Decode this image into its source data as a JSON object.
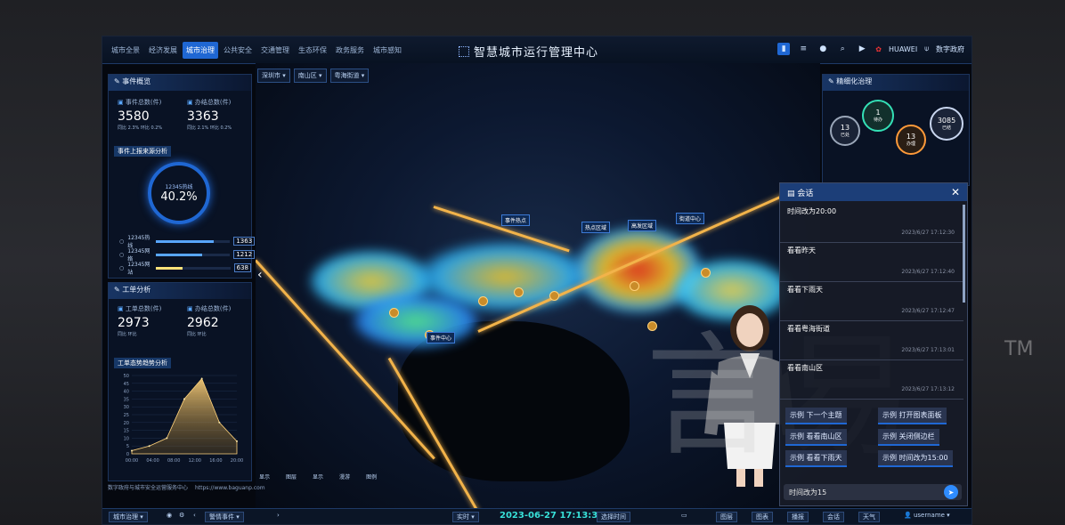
{
  "nav": {
    "items": [
      "城市全景",
      "经济发展",
      "城市治理",
      "公共安全",
      "交通管理",
      "生态环保",
      "政务服务",
      "城市感知"
    ],
    "active_index": 2
  },
  "header": {
    "title": "智慧城市运行管理中心"
  },
  "toolbar": {
    "brand_huawei": "HUAWEI",
    "brand_digital": "数字政府"
  },
  "map": {
    "selectors": [
      "深圳市",
      "南山区",
      "粤海街道"
    ],
    "labels": [
      "事件热点",
      "热点区域",
      "高发区域",
      "街道中心",
      "事件中心"
    ]
  },
  "left_top": {
    "title": "事件概览",
    "stat1_label": "事件总数(件)",
    "stat1_value": "3580",
    "stat1_cmp": "同比 2.3%  环比 0.2%",
    "stat2_label": "办结总数(件)",
    "stat2_value": "3363",
    "stat2_cmp": "同比 2.1%  环比 0.2%",
    "sub_title": "事件上报来源分析",
    "ring_label": "12345热线",
    "ring_value": "40.2%",
    "bars": [
      {
        "label": "12345热线",
        "value": "1363",
        "pct": 0.78
      },
      {
        "label": "12345网络",
        "value": "1212",
        "pct": 0.62
      },
      {
        "label": "12345网站",
        "value": "638",
        "pct": 0.35
      }
    ]
  },
  "left_bottom": {
    "title": "工单分析",
    "stat1_label": "工单总数(件)",
    "stat1_value": "2973",
    "stat1_cmp": "同比  环比",
    "stat2_label": "办结总数(件)",
    "stat2_value": "2962",
    "stat2_cmp": "同比  环比",
    "chart_title": "工单态势趋势分析",
    "footnote": "数字政府与城市安全运营服务中心",
    "url": "https://www.baguanp.com"
  },
  "chart_data": {
    "type": "area",
    "title": "工单态势趋势分析",
    "x": [
      "00:00",
      "04:00",
      "08:00",
      "12:00",
      "16:00",
      "20:00"
    ],
    "values": [
      2,
      5,
      10,
      35,
      48,
      20,
      8
    ],
    "ylim": [
      0,
      50
    ],
    "yticks": [
      0,
      5,
      10,
      15,
      20,
      25,
      30,
      35,
      40,
      45,
      50
    ]
  },
  "right_top": {
    "title": "精细化治理",
    "bubbles": [
      {
        "value": "13",
        "label": "已处"
      },
      {
        "value": "1",
        "label": "待办"
      },
      {
        "value": "13",
        "label": "办理"
      },
      {
        "value": "3085",
        "label": "已结"
      }
    ]
  },
  "chat": {
    "title": "会话",
    "messages": [
      {
        "text": "时间改为20:00",
        "time": "2023/6/27 17:12:30"
      },
      {
        "text": "看看昨天",
        "time": "2023/6/27 17:12:40"
      },
      {
        "text": "看看下雨天",
        "time": "2023/6/27 17:12:47"
      },
      {
        "text": "看看粤海街道",
        "time": "2023/6/27 17:13:01"
      },
      {
        "text": "看看南山区",
        "time": "2023/6/27 17:13:12"
      }
    ],
    "suggestions": [
      "示例 下一个主题",
      "示例 打开图表面板",
      "示例 看看南山区",
      "示例 关闭侧边栏",
      "示例 看看下雨天",
      "示例 时间改为15:00"
    ],
    "input_value": "时间改为15",
    "send_icon": "send-icon"
  },
  "watermark": {
    "tm": "TM"
  },
  "bottombar": {
    "governance": "城市治理",
    "event_select": "警情事件",
    "mode": "实时",
    "datetime": "2023-06-27 17:13:35",
    "tag": "选择时间",
    "buttons": [
      "图层",
      "图表",
      "播报",
      "会话",
      "天气"
    ],
    "user": "username"
  },
  "map_tools": {
    "labels": [
      "显示",
      "图层",
      "显示",
      "漫游",
      "图例"
    ]
  }
}
